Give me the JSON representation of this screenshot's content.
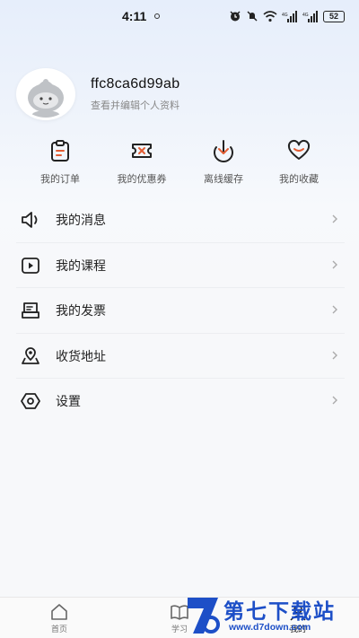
{
  "status_bar": {
    "time": "4:11",
    "battery": "52"
  },
  "profile": {
    "username": "ffc8ca6d99ab",
    "subtitle": "查看并编辑个人资料"
  },
  "quick_actions": [
    {
      "label": "我的订单",
      "icon": "clipboard-icon"
    },
    {
      "label": "我的优惠券",
      "icon": "coupon-icon"
    },
    {
      "label": "离线缓存",
      "icon": "download-icon"
    },
    {
      "label": "我的收藏",
      "icon": "heart-icon"
    }
  ],
  "menu": [
    {
      "label": "我的消息",
      "icon": "speaker-icon"
    },
    {
      "label": "我的课程",
      "icon": "play-icon"
    },
    {
      "label": "我的发票",
      "icon": "invoice-icon"
    },
    {
      "label": "收货地址",
      "icon": "location-icon"
    },
    {
      "label": "设置",
      "icon": "settings-icon"
    }
  ],
  "bottom_nav": [
    {
      "label": "首页",
      "icon": "home-icon"
    },
    {
      "label": "学习",
      "icon": "book-icon"
    },
    {
      "label": "我的",
      "icon": "user-icon",
      "active": true
    }
  ],
  "watermark": {
    "title": "第七下载站",
    "url": "www.d7down.com"
  },
  "colors": {
    "accent": "#e35d33",
    "watermark": "#1d4fc7",
    "text": "#222222",
    "subtext": "#888888"
  }
}
